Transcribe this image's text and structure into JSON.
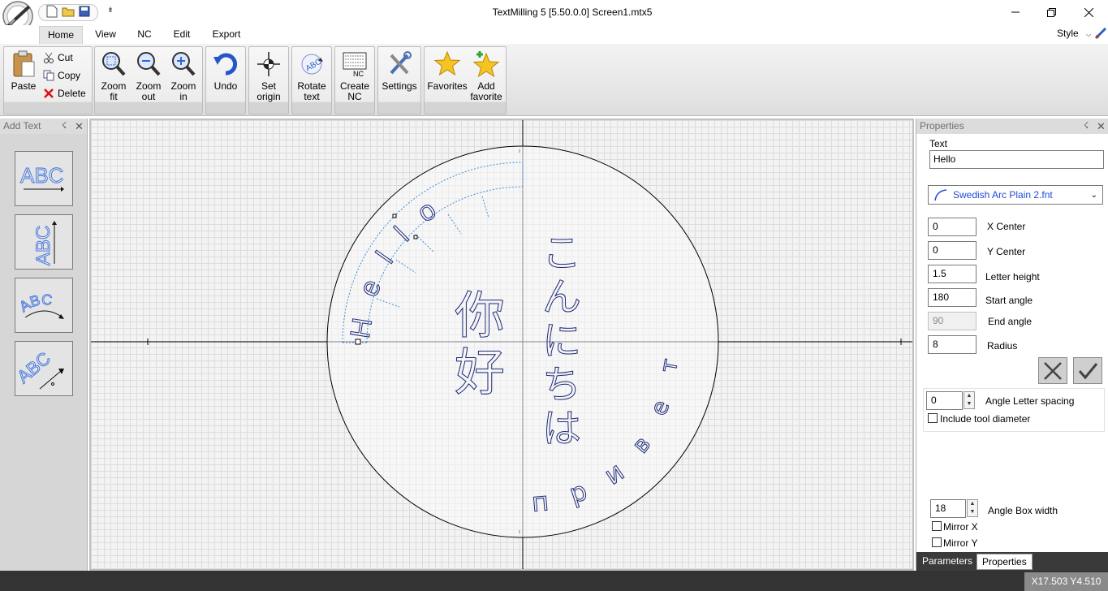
{
  "window": {
    "title": "TextMilling 5 [5.50.0.0]   Screen1.mtx5",
    "qat_more": "⇟"
  },
  "menu": {
    "tabs": [
      "Home",
      "View",
      "NC",
      "Edit",
      "Export"
    ],
    "style": "Style"
  },
  "ribbon": {
    "paste": "Paste",
    "cut": "Cut",
    "copy": "Copy",
    "delete": "Delete",
    "zoom_fit": [
      "Zoom",
      "fit"
    ],
    "zoom_out": [
      "Zoom",
      "out"
    ],
    "zoom_in": [
      "Zoom",
      "in"
    ],
    "undo": "Undo",
    "set_origin": [
      "Set",
      "origin"
    ],
    "rotate_text": [
      "Rotate",
      "text"
    ],
    "create_nc": [
      "Create",
      "NC"
    ],
    "settings": "Settings",
    "favorites": "Favorites",
    "add_favorite": [
      "Add",
      "favorite"
    ]
  },
  "left_panel": {
    "title": "Add Text",
    "tiles": [
      {
        "name": "straight-text",
        "label": "ABC"
      },
      {
        "name": "vertical-text",
        "label": "ABC"
      },
      {
        "name": "arc-text",
        "label": "ABC"
      },
      {
        "name": "angled-text",
        "label": "ABC"
      }
    ]
  },
  "canvas": {
    "arc_text": "Hello",
    "chinese": [
      "你",
      "好"
    ],
    "japanese": [
      "こ",
      "ん",
      "に",
      "ち",
      "は"
    ],
    "russian_letters": [
      "п",
      "р",
      "и",
      "в",
      "е",
      "т"
    ]
  },
  "properties": {
    "title": "Properties",
    "text_label": "Text",
    "text_value": "Hello",
    "font": "Swedish Arc Plain 2.fnt",
    "fields": {
      "x_center": {
        "label": "X Center",
        "value": "0"
      },
      "y_center": {
        "label": "Y Center",
        "value": "0"
      },
      "letter_height": {
        "label": "Letter height",
        "value": "1.5"
      },
      "start_angle": {
        "label": "Start angle",
        "value": "180"
      },
      "end_angle": {
        "label": "End angle",
        "value": "90"
      },
      "radius": {
        "label": "Radius",
        "value": "8"
      }
    },
    "angle_letter_spacing": {
      "label": "Angle Letter spacing",
      "value": "0"
    },
    "include_tool_diameter": "Include tool diameter",
    "angle_box_width": {
      "label": "Angle Box width",
      "value": "18"
    },
    "mirror_x": "Mirror X",
    "mirror_y": "Mirror Y",
    "bottom_tabs": [
      "Parameters",
      "Properties"
    ]
  },
  "status": {
    "coords": "X17.503  Y4.510"
  },
  "colors": {
    "accent_blue": "#1f4bd8",
    "text_outline": "#1e2a78",
    "status_bg": "#333333"
  }
}
